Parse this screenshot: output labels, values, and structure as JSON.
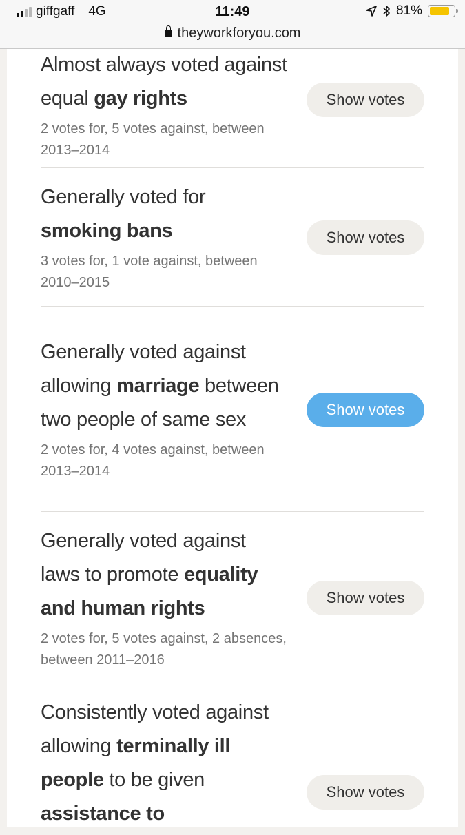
{
  "status_bar": {
    "carrier": "giffgaff",
    "network": "4G",
    "time": "11:49",
    "battery_percent_label": "81%",
    "battery_level": 0.81,
    "signal_bars_active": 2,
    "signal_bars_total": 4,
    "icons": [
      "location-arrow-icon",
      "bluetooth-icon",
      "battery-icon"
    ]
  },
  "browser": {
    "url": "theyworkforyou.com",
    "secure": true
  },
  "colors": {
    "active_button": "#5aaeea",
    "default_button": "#f0eeea",
    "battery_fill": "#f5c400"
  },
  "votes": [
    {
      "parts": [
        {
          "text": "Almost always voted against equal ",
          "bold": false
        },
        {
          "text": "gay rights",
          "bold": true
        }
      ],
      "summary": "2 votes for, 5 votes against, between 2013–2014",
      "button_label": "Show votes",
      "active": false
    },
    {
      "parts": [
        {
          "text": "Generally voted for ",
          "bold": false
        },
        {
          "text": "smoking bans",
          "bold": true
        }
      ],
      "summary": "3 votes for, 1 vote against, between 2010–2015",
      "button_label": "Show votes",
      "active": false
    },
    {
      "parts": [
        {
          "text": "Generally voted against allowing ",
          "bold": false
        },
        {
          "text": "marriage",
          "bold": true
        },
        {
          "text": " between two people of same sex",
          "bold": false
        }
      ],
      "summary": "2 votes for, 4 votes against, between 2013–2014",
      "button_label": "Show votes",
      "active": true
    },
    {
      "parts": [
        {
          "text": "Generally voted against laws to promote ",
          "bold": false
        },
        {
          "text": "equality and human rights",
          "bold": true
        }
      ],
      "summary": "2 votes for, 5 votes against, 2 absences, between 2011–2016",
      "button_label": "Show votes",
      "active": false
    },
    {
      "parts": [
        {
          "text": "Consistently voted against allowing ",
          "bold": false
        },
        {
          "text": "terminally ill people",
          "bold": true
        },
        {
          "text": " to be given ",
          "bold": false
        },
        {
          "text": "assistance to",
          "bold": true
        }
      ],
      "summary": "",
      "button_label": "Show votes",
      "active": false
    }
  ]
}
